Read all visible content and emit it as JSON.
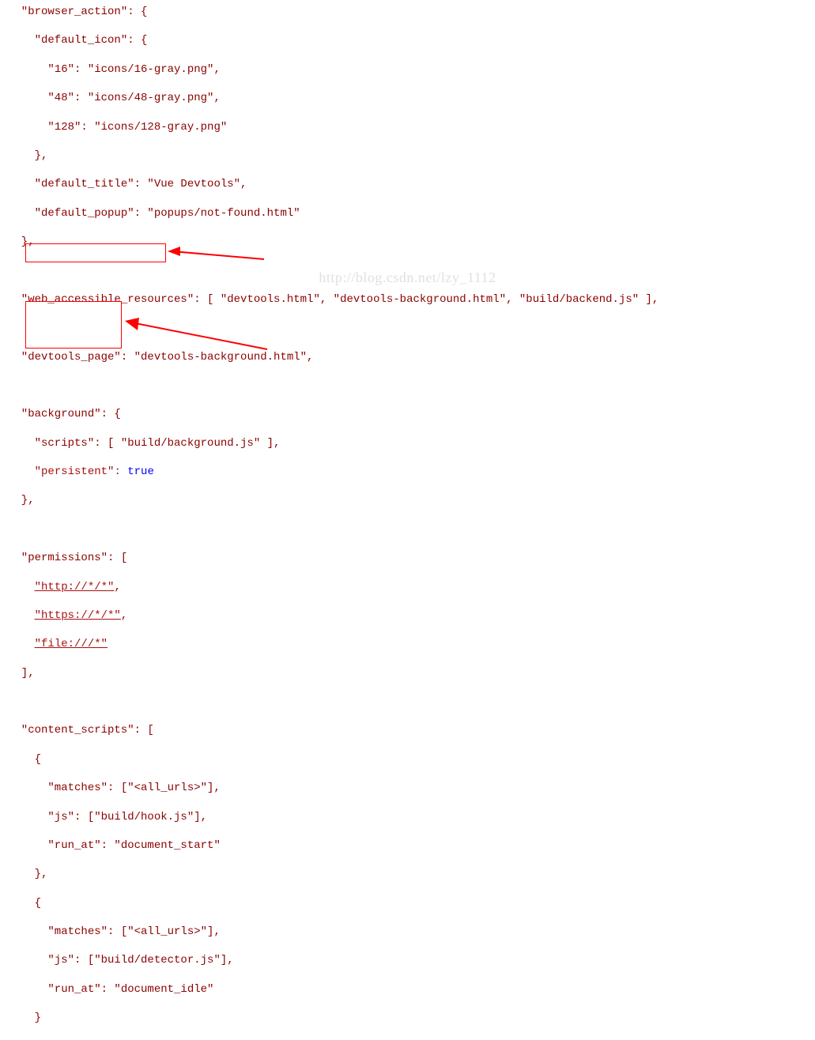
{
  "watermark": "http://blog.csdn.net/lzy_1112",
  "annotations": {
    "box1_target": "\"persistent\": true",
    "box2_target": "permissions URL patterns"
  },
  "code": {
    "l01": "  \"browser_action\": {",
    "l02": "    \"default_icon\": {",
    "l03": "      \"16\": \"icons/16-gray.png\",",
    "l04": "      \"48\": \"icons/48-gray.png\",",
    "l05": "      \"128\": \"icons/128-gray.png\"",
    "l06": "    },",
    "l07": "    \"default_title\": \"Vue Devtools\",",
    "l08": "    \"default_popup\": \"popups/not-found.html\"",
    "l09": "  },",
    "l10": "",
    "l11": "  \"web_accessible_resources\": [ \"devtools.html\", \"devtools-background.html\", \"build/backend.js\" ],",
    "l12": "",
    "l13": "  \"devtools_page\": \"devtools-background.html\",",
    "l14": "",
    "l15": "  \"background\": {",
    "l16": "    \"scripts\": [ \"build/background.js\" ],",
    "l17_pre": "    ",
    "l17_key": "\"persistent\"",
    "l17_sep": ": ",
    "l17_val": "true",
    "l18": "  },",
    "l19": "",
    "l20": "  \"permissions\": [",
    "l21_pre": "    ",
    "l21_val": "\"http://*/*\"",
    "l21_post": ",",
    "l22_pre": "    ",
    "l22_val": "\"https://*/*\"",
    "l22_post": ",",
    "l23_pre": "    ",
    "l23_val": "\"file:///*\"",
    "l24": "  ],",
    "l25": "",
    "l26": "  \"content_scripts\": [",
    "l27": "    {",
    "l28": "      \"matches\": [\"<all_urls>\"],",
    "l29": "      \"js\": [\"build/hook.js\"],",
    "l30": "      \"run_at\": \"document_start\"",
    "l31": "    },",
    "l32": "    {",
    "l33": "      \"matches\": [\"<all_urls>\"],",
    "l34": "      \"js\": [\"build/detector.js\"],",
    "l35": "      \"run_at\": \"document_idle\"",
    "l36": "    }"
  }
}
